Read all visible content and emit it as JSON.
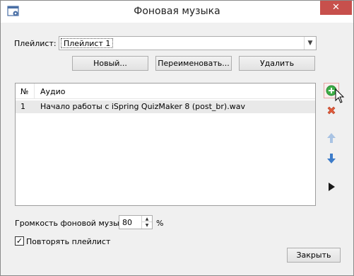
{
  "window": {
    "title": "Фоновая музыка",
    "close_label": "✕"
  },
  "playlist": {
    "label": "Плейлист:",
    "selected": "Плейлист 1",
    "dropdown_arrow": "▼"
  },
  "buttons": {
    "new": "Новый...",
    "rename": "Переименовать...",
    "delete": "Удалить",
    "close": "Закрыть"
  },
  "table": {
    "columns": [
      "№",
      "Аудио"
    ],
    "rows": [
      {
        "no": "1",
        "audio": "Начало работы с iSpring QuizMaker 8 (post_br).wav"
      }
    ]
  },
  "side_toolbar": {
    "icons": [
      "add-icon",
      "remove-icon",
      "move-up-icon",
      "move-down-icon",
      "play-icon"
    ]
  },
  "volume": {
    "label": "Громкость фоновой музыки:",
    "value": "80",
    "unit": "%"
  },
  "repeat": {
    "label": "Повторять плейлист",
    "checked": true,
    "check_mark": "✓"
  },
  "colors": {
    "accent_close": "#c7504c",
    "add_green": "#3fae48",
    "remove_red": "#e05a3a",
    "arrow_blue": "#3d7cc9"
  }
}
